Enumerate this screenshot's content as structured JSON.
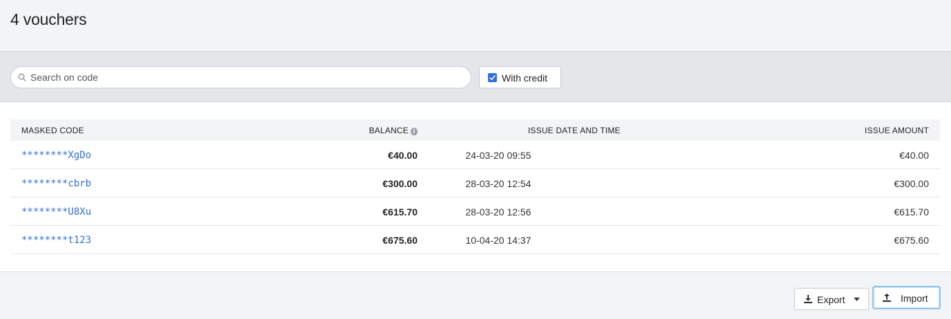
{
  "header": {
    "title": "4 vouchers"
  },
  "filters": {
    "search_placeholder": "Search on code",
    "search_value": "",
    "with_credit_label": "With credit",
    "with_credit_checked": true
  },
  "table": {
    "columns": {
      "code": "MASKED CODE",
      "balance": "BALANCE",
      "issue_date": "ISSUE DATE AND TIME",
      "issue_amount": "ISSUE AMOUNT"
    },
    "rows": [
      {
        "code": "********XgDo",
        "balance": "€40.00",
        "issue_date": "24-03-20 09:55",
        "issue_amount": "€40.00"
      },
      {
        "code": "********cbrb",
        "balance": "€300.00",
        "issue_date": "28-03-20 12:54",
        "issue_amount": "€300.00"
      },
      {
        "code": "********U8Xu",
        "balance": "€615.70",
        "issue_date": "28-03-20 12:56",
        "issue_amount": "€615.70"
      },
      {
        "code": "********t123",
        "balance": "€675.60",
        "issue_date": "10-04-20 14:37",
        "issue_amount": "€675.60"
      }
    ]
  },
  "footer": {
    "export_label": "Export",
    "import_label": "Import"
  },
  "colors": {
    "accent": "#2f6fdf",
    "focus_ring": "#8ec4f0"
  },
  "icons": {
    "search": "search-icon",
    "info": "info-icon",
    "download": "download-icon",
    "upload": "upload-icon",
    "caret": "caret-down-icon",
    "check": "check-icon"
  }
}
